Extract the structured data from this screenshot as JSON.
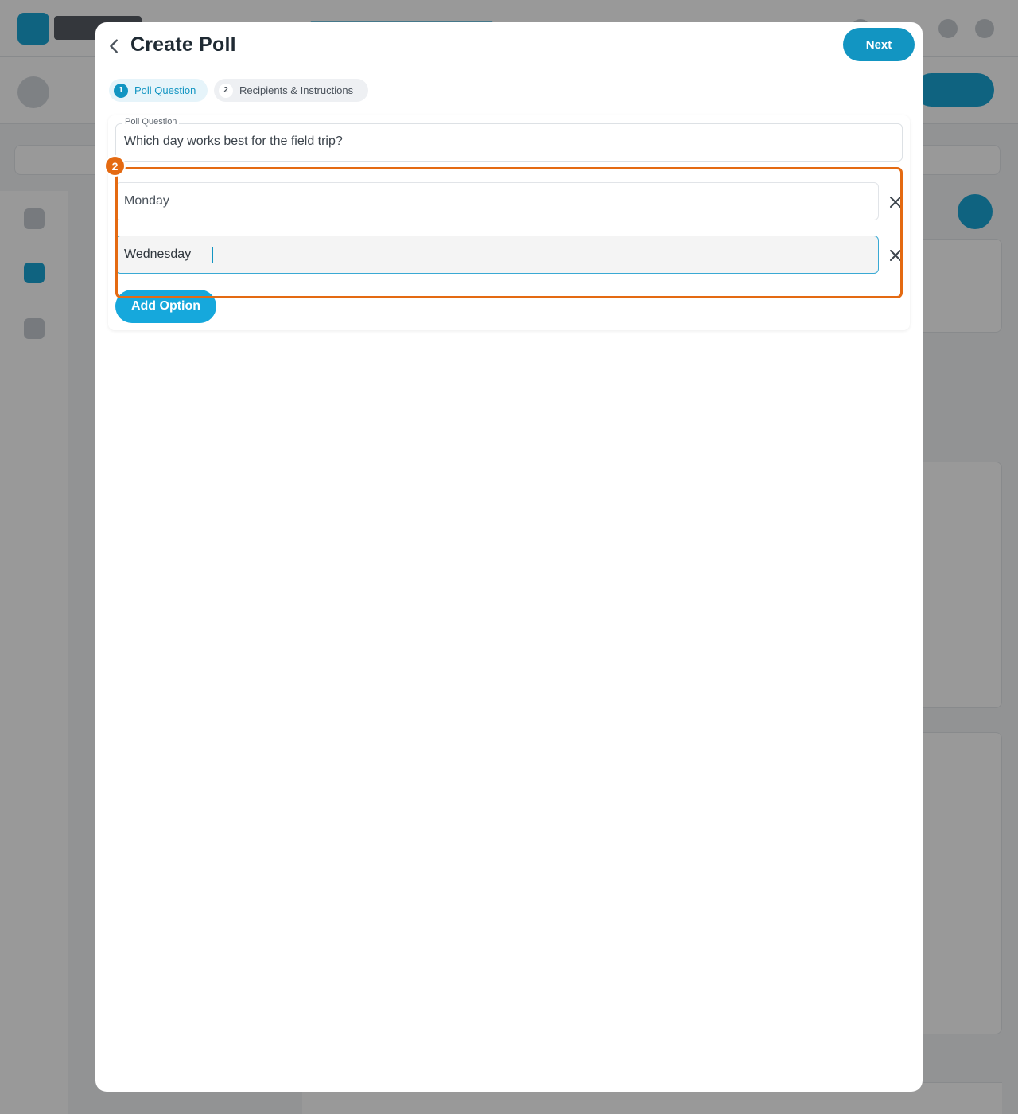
{
  "modal": {
    "title": "Create Poll",
    "next_label": "Next"
  },
  "steps": [
    {
      "number": "1",
      "label": "Poll Question",
      "active": true
    },
    {
      "number": "2",
      "label": "Recipients & Instructions",
      "active": false
    }
  ],
  "question": {
    "label": "Poll Question",
    "value": "Which day works best for the field trip?"
  },
  "options": [
    {
      "value": "Monday",
      "focused": false
    },
    {
      "value": "Wednesday",
      "focused": true
    }
  ],
  "add_option_label": "Add Option",
  "annotation": {
    "badge": "2",
    "color": "#e46a12"
  },
  "colors": {
    "accent": "#1295c2",
    "button_bright": "#16a8dc",
    "focus_border": "#39a9d4"
  },
  "icons": {
    "back": "chevron-left-icon",
    "remove": "close-icon"
  }
}
